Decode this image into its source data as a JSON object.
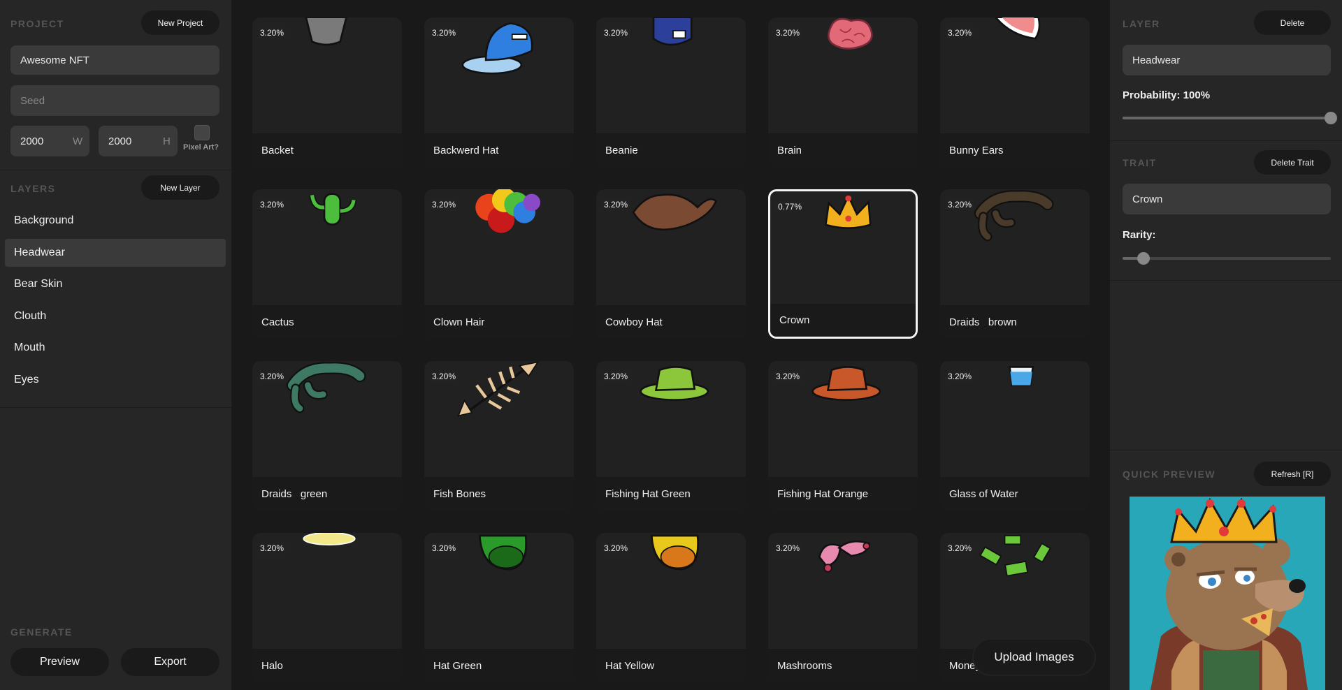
{
  "project": {
    "heading": "PROJECT",
    "new_button": "New Project",
    "name_value": "Awesome NFT",
    "seed_placeholder": "Seed",
    "width_value": "2000",
    "width_unit": "W",
    "height_value": "2000",
    "height_unit": "H",
    "pixel_art_label": "Pixel Art?"
  },
  "layers": {
    "heading": "LAYERS",
    "new_button": "New Layer",
    "items": [
      {
        "label": "Background"
      },
      {
        "label": "Headwear"
      },
      {
        "label": "Bear Skin"
      },
      {
        "label": "Clouth"
      },
      {
        "label": " Mouth"
      },
      {
        "label": "Eyes"
      }
    ],
    "active_index": 1
  },
  "generate": {
    "heading": "GENERATE",
    "preview_button": "Preview",
    "export_button": "Export"
  },
  "traits": [
    {
      "label": "Backet",
      "pct": "3.20%",
      "icon": "bucket-hat-icon",
      "color": "#7a7a7a"
    },
    {
      "label": "Backwerd Hat",
      "pct": "3.20%",
      "icon": "backward-cap-icon",
      "color": "#2f7fe0"
    },
    {
      "label": "Beanie",
      "pct": "3.20%",
      "icon": "beanie-icon",
      "color": "#2c3f9a"
    },
    {
      "label": "Brain",
      "pct": "3.20%",
      "icon": "brain-icon",
      "color": "#e26a78"
    },
    {
      "label": "Bunny Ears",
      "pct": "3.20%",
      "icon": "bunny-ears-icon",
      "color": "#f08c8c"
    },
    {
      "label": "Cactus",
      "pct": "3.20%",
      "icon": "cactus-icon",
      "color": "#4cbd3c"
    },
    {
      "label": "Clown Hair",
      "pct": "3.20%",
      "icon": "clown-hair-icon",
      "color": "#e6a21a"
    },
    {
      "label": "Cowboy Hat",
      "pct": "3.20%",
      "icon": "cowboy-hat-icon",
      "color": "#7a4a33"
    },
    {
      "label": "Crown",
      "pct": "0.77%",
      "icon": "crown-icon",
      "color": "#f2b01e"
    },
    {
      "label": "Draids   brown",
      "pct": "3.20%",
      "icon": "dreads-brown-icon",
      "color": "#4a3a2a"
    },
    {
      "label": "Draids   green",
      "pct": "3.20%",
      "icon": "dreads-green-icon",
      "color": "#3e7a63"
    },
    {
      "label": "Fish Bones",
      "pct": "3.20%",
      "icon": "fish-bones-icon",
      "color": "#e8c89a"
    },
    {
      "label": "Fishing Hat Green",
      "pct": "3.20%",
      "icon": "fishing-hat-green-icon",
      "color": "#8cc63a"
    },
    {
      "label": "Fishing Hat Orange",
      "pct": "3.20%",
      "icon": "fishing-hat-orange-icon",
      "color": "#c8582a"
    },
    {
      "label": "Glass of Water",
      "pct": "3.20%",
      "icon": "glass-of-water-icon",
      "color": "#4aa8e8"
    },
    {
      "label": "Halo",
      "pct": "3.20%",
      "icon": "halo-icon",
      "color": "#f2ea8a"
    },
    {
      "label": "Hat Green",
      "pct": "3.20%",
      "icon": "hat-green-icon",
      "color": "#2a9a2a"
    },
    {
      "label": "Hat Yellow",
      "pct": "3.20%",
      "icon": "hat-yellow-icon",
      "color": "#e8c81a"
    },
    {
      "label": "Mashrooms",
      "pct": "3.20%",
      "icon": "mushrooms-icon",
      "color": "#e88ab0"
    },
    {
      "label": "Money",
      "pct": "3.20%",
      "icon": "money-icon",
      "color": "#6ac83a"
    }
  ],
  "selected_trait_index": 8,
  "upload_button": "Upload Images",
  "layer_panel": {
    "heading": "LAYER",
    "delete_button": "Delete",
    "name_value": "Headwear",
    "probability_label": "Probability: 100%",
    "probability": 1.0
  },
  "trait_panel": {
    "heading": "TRAIT",
    "delete_button": "Delete Trait",
    "name_value": "Crown",
    "rarity_label": "Rarity:",
    "rarity": 0.1
  },
  "quick_preview": {
    "heading": "QUICK PREVIEW",
    "refresh_button": "Refresh [R]"
  },
  "colors": {
    "panel": "#262626",
    "canvas": "#191919",
    "card": "#212121",
    "button": "#1a1a1a",
    "preview_bg": "#27a7b8"
  }
}
